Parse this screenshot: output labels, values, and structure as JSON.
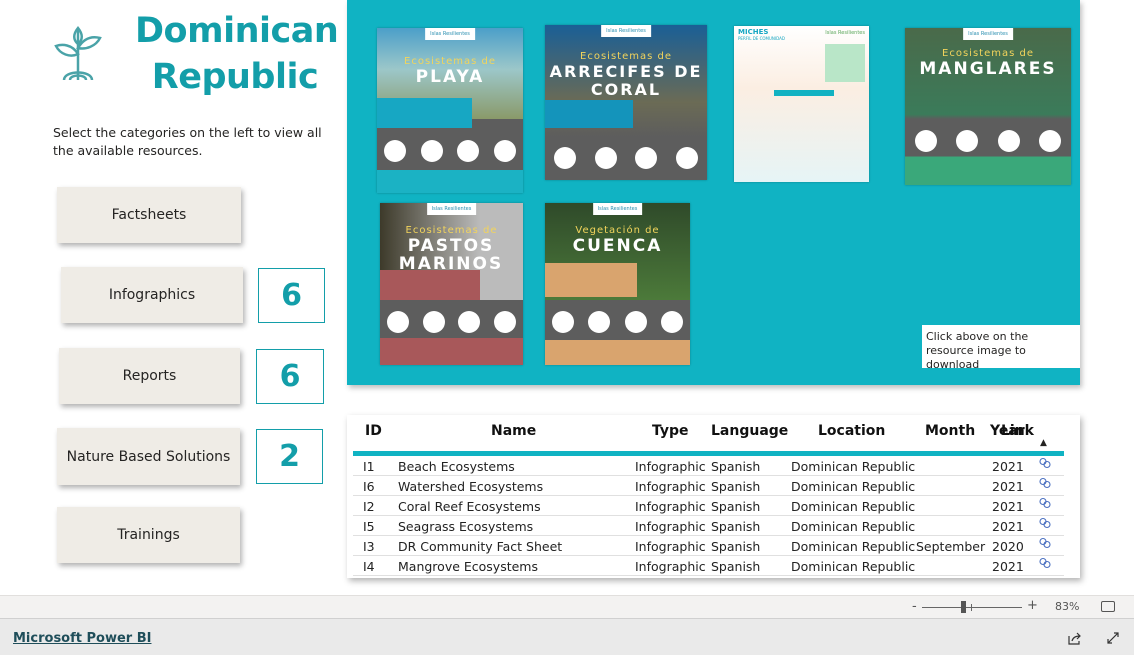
{
  "header": {
    "title_line1": "Dominican",
    "title_line2": "Republic",
    "description": "Select the categories on the left to view all the available resources.",
    "brand_color": "#139ea9"
  },
  "categories": [
    {
      "label": "Factsheets"
    },
    {
      "label": "Infographics",
      "count": "6"
    },
    {
      "label": "Reports",
      "count": "6"
    },
    {
      "label": "Nature Based Solutions",
      "count": "2"
    },
    {
      "label": "Trainings"
    }
  ],
  "gallery": {
    "background": "#10b3c3",
    "thumbnails": [
      {
        "logo": "Islas Resilientes",
        "subtitle": "Ecosistemas de",
        "title": "PLAYA"
      },
      {
        "logo": "Islas Resilientes",
        "subtitle": "Ecosistemas de",
        "title": "ARRECIFES DE CORAL"
      },
      {
        "logo": "Islas Resilientes",
        "subtitle": "PERFIL DE COMUNIDAD",
        "title": "MICHES"
      },
      {
        "logo": "Islas Resilientes",
        "subtitle": "Ecosistemas de",
        "title": "MANGLARES"
      },
      {
        "logo": "Islas Resilientes",
        "subtitle": "Ecosistemas de",
        "title": "PASTOS MARINOS"
      },
      {
        "logo": "Islas Resilientes",
        "subtitle": "Vegetación de",
        "title": "CUENCA"
      }
    ],
    "hint": "Click above on the resource image to download"
  },
  "table": {
    "columns": [
      "ID",
      "Name",
      "Type",
      "Language",
      "Location",
      "Month",
      "Year",
      "Link"
    ],
    "sort_indicator": "▲",
    "rows": [
      {
        "id": "I1",
        "name": "Beach Ecosystems",
        "type": "Infographic",
        "language": "Spanish",
        "location": "Dominican Republic",
        "month": "",
        "year": "2021"
      },
      {
        "id": "I6",
        "name": "Watershed Ecosystems",
        "type": "Infographic",
        "language": "Spanish",
        "location": "Dominican Republic",
        "month": "",
        "year": "2021"
      },
      {
        "id": "I2",
        "name": "Coral Reef Ecosystems",
        "type": "Infographic",
        "language": "Spanish",
        "location": "Dominican Republic",
        "month": "",
        "year": "2021"
      },
      {
        "id": "I5",
        "name": "Seagrass Ecosystems",
        "type": "Infographic",
        "language": "Spanish",
        "location": "Dominican Republic",
        "month": "",
        "year": "2021"
      },
      {
        "id": "I3",
        "name": "DR Community Fact Sheet",
        "type": "Infographic",
        "language": "Spanish",
        "location": "Dominican Republic",
        "month": "September",
        "year": "2020"
      },
      {
        "id": "I4",
        "name": "Mangrove Ecosystems",
        "type": "Infographic",
        "language": "Spanish",
        "location": "Dominican Republic",
        "month": "",
        "year": "2021"
      }
    ]
  },
  "zoom": {
    "minus": "-",
    "plus": "+",
    "level": "83%",
    "value_percent": 83
  },
  "footer": {
    "link": "Microsoft Power BI"
  }
}
